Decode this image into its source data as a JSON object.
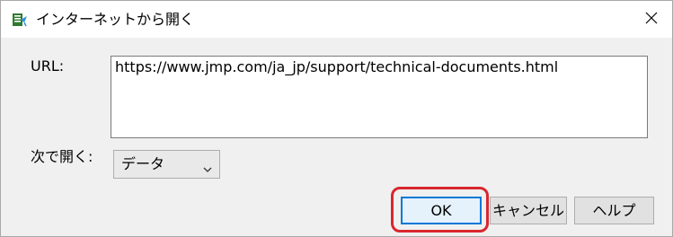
{
  "window": {
    "title": "インターネットから開く",
    "app_icon": "jmp-open-url-icon",
    "close_icon": "close-icon"
  },
  "form": {
    "url_label": "URL:",
    "url_value": "https://www.jmp.com/ja_jp/support/technical-documents.html",
    "open_as_label": "次で開く:",
    "open_as_value": "データ",
    "open_as_arrow_icon": "chevron-down-icon"
  },
  "buttons": {
    "ok": "OK",
    "cancel": "キャンセル",
    "help": "ヘルプ"
  },
  "annotation": {
    "highlight_color": "#d9262f"
  },
  "colors": {
    "accent": "#0078d7",
    "dialog_bg": "#f0f0f0"
  }
}
